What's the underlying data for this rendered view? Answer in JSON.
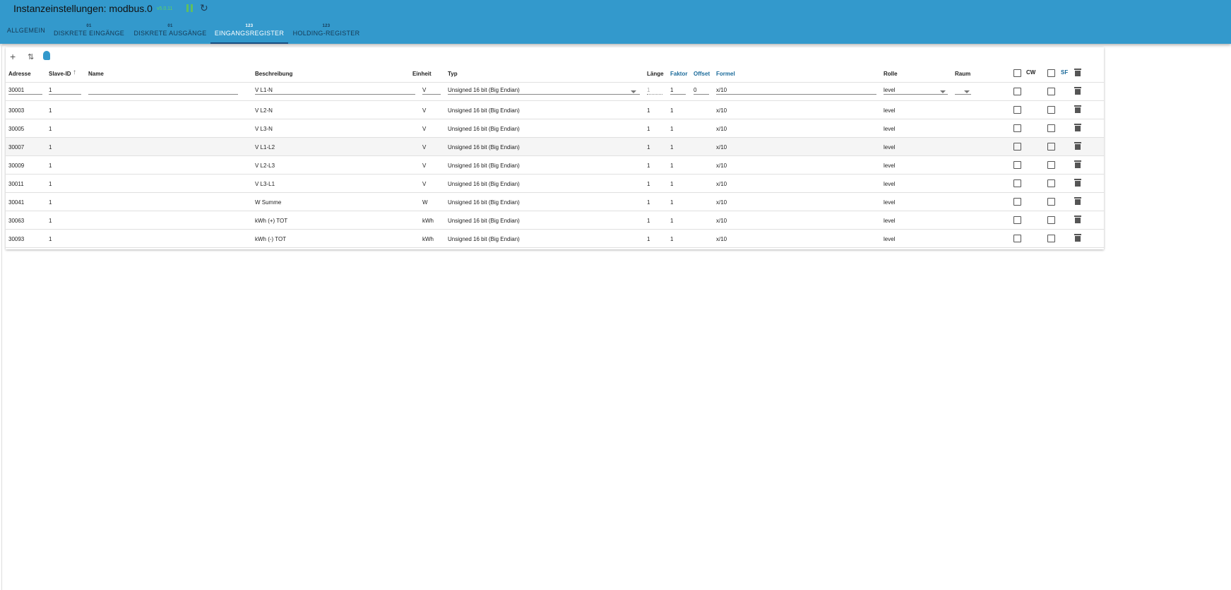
{
  "header": {
    "title": "Instanzeinstellungen: modbus.0",
    "version": "v5.0.11"
  },
  "tabs": [
    {
      "label": "ALLGEMEIN",
      "badge": ""
    },
    {
      "label": "DISKRETE EINGÄNGE",
      "badge": "01"
    },
    {
      "label": "DISKRETE AUSGÄNGE",
      "badge": "01"
    },
    {
      "label": "EINGANGSREGISTER",
      "badge": "123"
    },
    {
      "label": "HOLDING-REGISTER",
      "badge": "123"
    }
  ],
  "columns": {
    "address": "Adresse",
    "slave": "Slave-ID",
    "name": "Name",
    "desc": "Beschreibung",
    "unit": "Einheit",
    "type": "Typ",
    "len": "Länge",
    "factor": "Faktor",
    "offset": "Offset",
    "formula": "Formel",
    "role": "Rolle",
    "room": "Raum",
    "cw": "CW",
    "sf": "SF"
  },
  "rows": [
    {
      "address": "30001",
      "slave": "1",
      "name": "",
      "desc": "V L1-N",
      "unit": "V",
      "type": "Unsigned 16 bit (Big Endian)",
      "len": "1",
      "factor": "1",
      "offset": "0",
      "formula": "x/10",
      "role": "level",
      "room": ""
    },
    {
      "address": "30003",
      "slave": "1",
      "name": "",
      "desc": "V L2-N",
      "unit": "V",
      "type": "Unsigned 16 bit (Big Endian)",
      "len": "1",
      "factor": "1",
      "offset": "",
      "formula": "x/10",
      "role": "level",
      "room": ""
    },
    {
      "address": "30005",
      "slave": "1",
      "name": "",
      "desc": "V L3-N",
      "unit": "V",
      "type": "Unsigned 16 bit (Big Endian)",
      "len": "1",
      "factor": "1",
      "offset": "",
      "formula": "x/10",
      "role": "level",
      "room": ""
    },
    {
      "address": "30007",
      "slave": "1",
      "name": "",
      "desc": "V L1-L2",
      "unit": "V",
      "type": "Unsigned 16 bit (Big Endian)",
      "len": "1",
      "factor": "1",
      "offset": "",
      "formula": "x/10",
      "role": "level",
      "room": ""
    },
    {
      "address": "30009",
      "slave": "1",
      "name": "",
      "desc": "V L2-L3",
      "unit": "V",
      "type": "Unsigned 16 bit (Big Endian)",
      "len": "1",
      "factor": "1",
      "offset": "",
      "formula": "x/10",
      "role": "level",
      "room": ""
    },
    {
      "address": "30011",
      "slave": "1",
      "name": "",
      "desc": "V L3-L1",
      "unit": "V",
      "type": "Unsigned 16 bit (Big Endian)",
      "len": "1",
      "factor": "1",
      "offset": "",
      "formula": "x/10",
      "role": "level",
      "room": ""
    },
    {
      "address": "30041",
      "slave": "1",
      "name": "",
      "desc": "W Summe",
      "unit": "W",
      "type": "Unsigned 16 bit (Big Endian)",
      "len": "1",
      "factor": "1",
      "offset": "",
      "formula": "x/10",
      "role": "level",
      "room": ""
    },
    {
      "address": "30063",
      "slave": "1",
      "name": "",
      "desc": "kWh (+) TOT",
      "unit": "kWh",
      "type": "Unsigned 16 bit (Big Endian)",
      "len": "1",
      "factor": "1",
      "offset": "",
      "formula": "x/10",
      "role": "level",
      "room": ""
    },
    {
      "address": "30093",
      "slave": "1",
      "name": "",
      "desc": "kWh (-) TOT",
      "unit": "kWh",
      "type": "Unsigned 16 bit (Big Endian)",
      "len": "1",
      "factor": "1",
      "offset": "",
      "formula": "x/10",
      "role": "level",
      "room": ""
    }
  ]
}
